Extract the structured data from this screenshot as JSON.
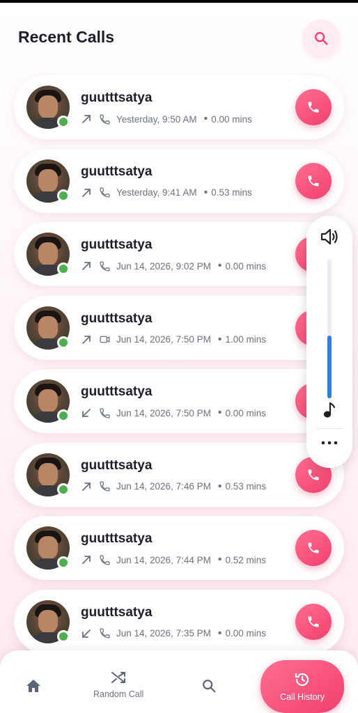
{
  "header": {
    "title": "Recent Calls",
    "search_icon": "search-icon"
  },
  "calls": [
    {
      "name": "guutttsatya",
      "direction": "outgoing",
      "type": "voice",
      "time": "Yesterday, 9:50 AM",
      "duration": "0.00 mins",
      "online": true
    },
    {
      "name": "guutttsatya",
      "direction": "outgoing",
      "type": "voice",
      "time": "Yesterday, 9:41 AM",
      "duration": "0.53 mins",
      "online": true
    },
    {
      "name": "guutttsatya",
      "direction": "outgoing",
      "type": "voice",
      "time": "Jun 14, 2026, 9:02 PM",
      "duration": "0.00 mins",
      "online": true
    },
    {
      "name": "guutttsatya",
      "direction": "outgoing",
      "type": "video",
      "time": "Jun 14, 2026, 7:50 PM",
      "duration": "1.00 mins",
      "online": true
    },
    {
      "name": "guutttsatya",
      "direction": "incoming",
      "type": "voice",
      "time": "Jun 14, 2026, 7:50 PM",
      "duration": "0.00 mins",
      "online": true
    },
    {
      "name": "guutttsatya",
      "direction": "outgoing",
      "type": "voice",
      "time": "Jun 14, 2026, 7:46 PM",
      "duration": "0.53 mins",
      "online": true
    },
    {
      "name": "guutttsatya",
      "direction": "outgoing",
      "type": "voice",
      "time": "Jun 14, 2026, 7:44 PM",
      "duration": "0.52 mins",
      "online": true
    },
    {
      "name": "guutttsatya",
      "direction": "incoming",
      "type": "voice",
      "time": "Jun 14, 2026, 7:35 PM",
      "duration": "0.00 mins",
      "online": true
    }
  ],
  "volume_overlay": {
    "level": 0.45,
    "speaker_icon": "speaker-icon",
    "music_icon": "music-note-icon",
    "more_icon": "more-dots-icon"
  },
  "bottom_nav": {
    "items": [
      {
        "label": "",
        "icon": "home-icon"
      },
      {
        "label": "Random Call",
        "icon": "shuffle-icon"
      },
      {
        "label": "",
        "icon": "search-icon"
      },
      {
        "label": "Call History",
        "icon": "history-icon",
        "active": true
      }
    ]
  },
  "colors": {
    "accent": "#f23f6e",
    "online": "#4caf50",
    "volume": "#2f7de1"
  }
}
